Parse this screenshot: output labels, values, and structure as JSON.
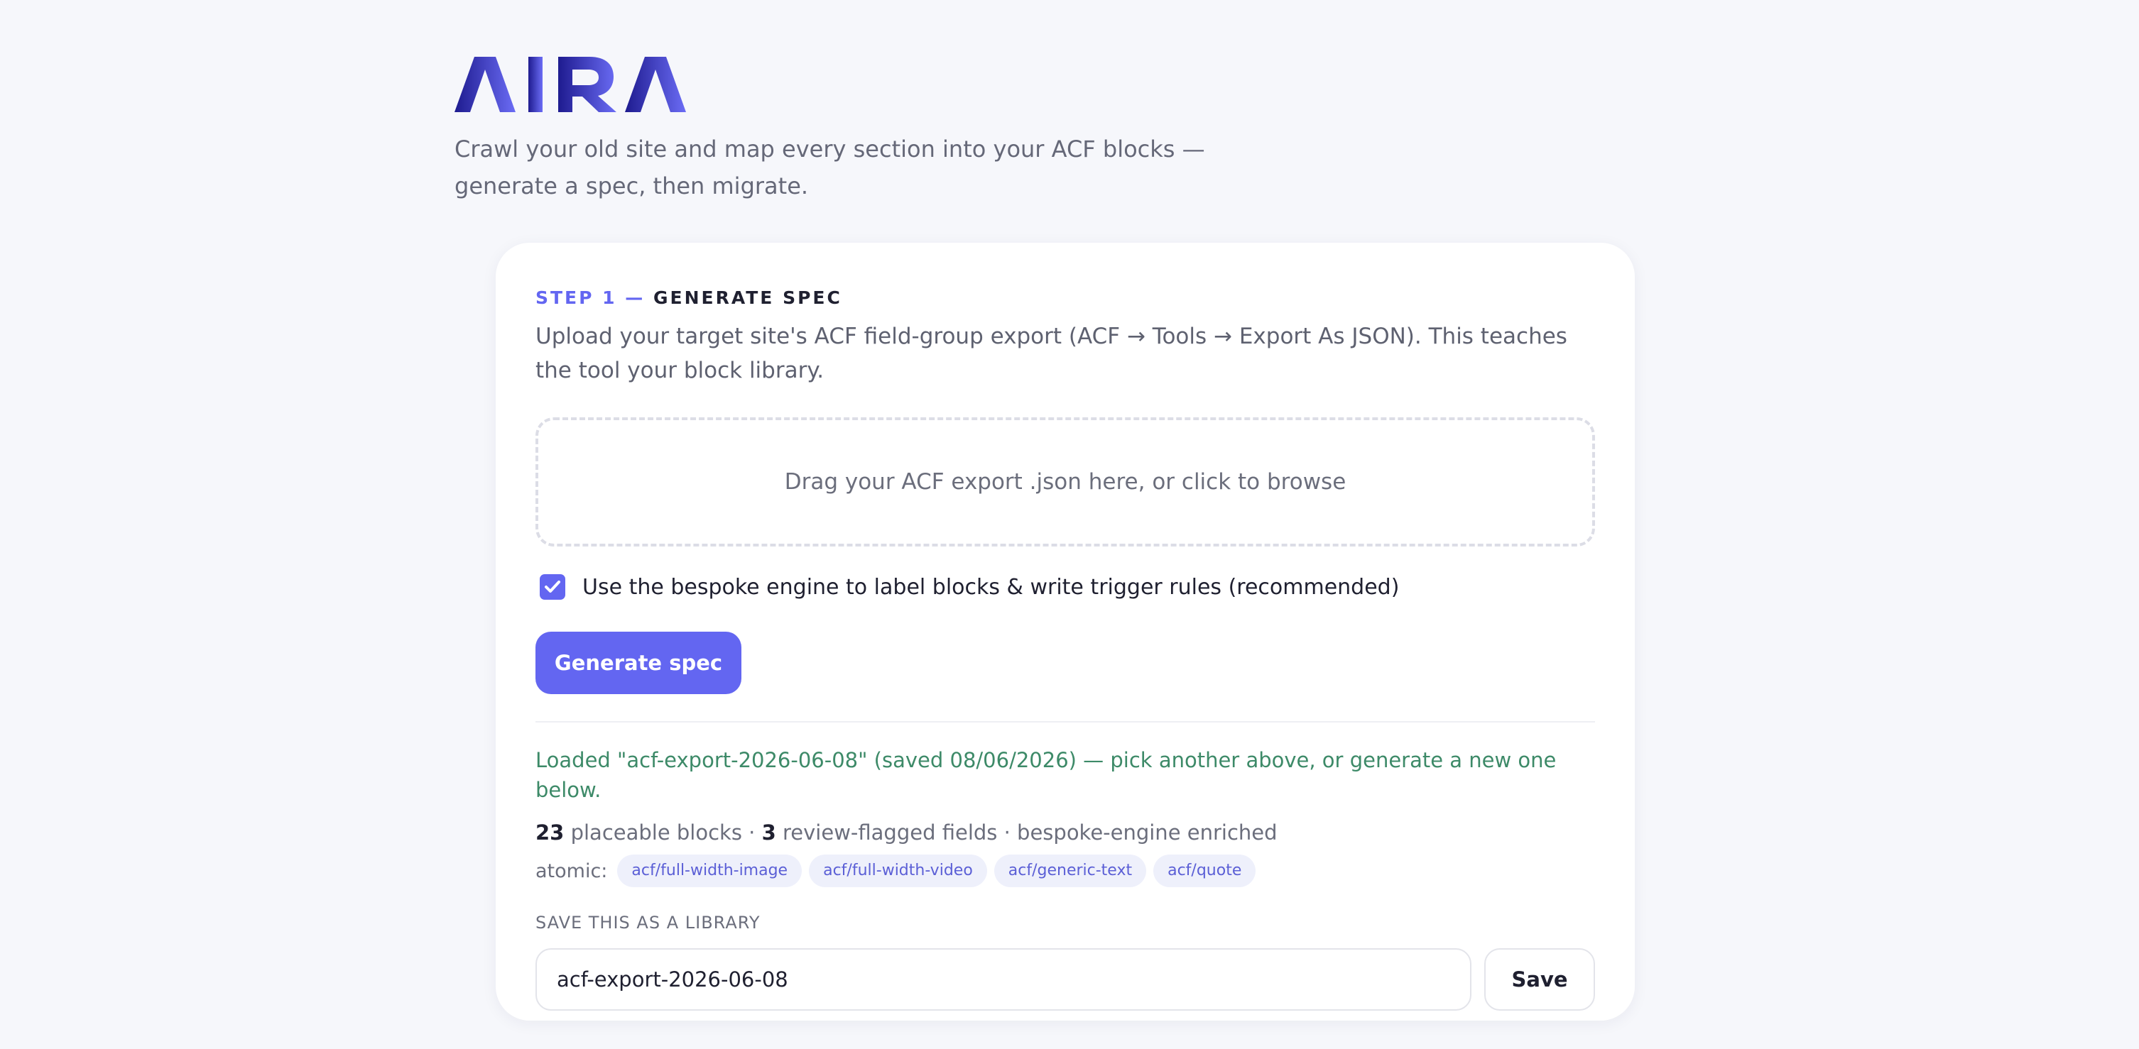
{
  "brand": {
    "logo_text": "AIRA",
    "tagline": "Crawl your old site and map every section into your ACF blocks — generate a spec, then migrate.",
    "colors": {
      "gradient_start": "#1e1b8f",
      "gradient_end": "#6b6cf5"
    }
  },
  "step": {
    "number": "STEP 1",
    "separator": " — ",
    "name": "GENERATE SPEC",
    "description": "Upload your target site's ACF field-group export (ACF → Tools → Export As JSON). This teaches the tool your block library."
  },
  "dropzone": {
    "text": "Drag your ACF export .json here, or click to browse"
  },
  "checkbox": {
    "checked": true,
    "label": "Use the bespoke engine to label blocks & write trigger rules (recommended)",
    "icon": "checkmark-icon"
  },
  "generate_button": {
    "label": "Generate spec"
  },
  "loaded_message": "Loaded \"acf-export-2026-06-08\" (saved 08/06/2026) — pick another above, or generate a new one below.",
  "stats": {
    "placeable_count": "23",
    "placeable_label": " placeable blocks · ",
    "flagged_count": "3",
    "flagged_label": " review-flagged fields · bespoke-engine enriched"
  },
  "atomic": {
    "label": "atomic:",
    "chips": [
      "acf/full-width-image",
      "acf/full-width-video",
      "acf/generic-text",
      "acf/quote"
    ]
  },
  "save_library": {
    "label": "SAVE THIS AS A LIBRARY",
    "input_value": "acf-export-2026-06-08",
    "button_label": "Save"
  },
  "colors": {
    "accent": "#6366f1",
    "success_text": "#3d8a68",
    "background": "#f6f7fb"
  }
}
